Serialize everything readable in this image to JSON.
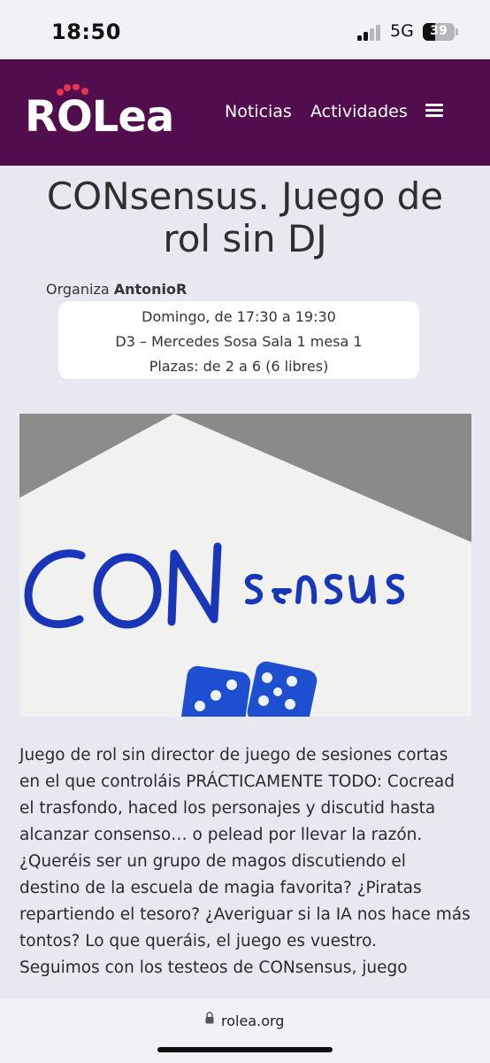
{
  "status_bar": {
    "time": "18:50",
    "network": "5G",
    "battery": "39",
    "battery_level": 0.39
  },
  "header": {
    "logo_text": "ROLea",
    "nav": [
      "Noticias",
      "Actividades"
    ],
    "menu_icon": "hamburger-menu-icon",
    "brand_color": "#520d4f",
    "logo_accent": "#e8344e"
  },
  "activity": {
    "title": "CONsensus. Juego de rol sin DJ",
    "organizer_prefix": "Organiza",
    "organizer": "AntonioR",
    "schedule": "Domingo, de 17:30 a 19:30",
    "location": "D3 – Mercedes Sosa Sala 1 mesa 1",
    "slots": "Plazas: de 2 a 6 (6 libres)"
  },
  "image": {
    "handwritten_text": "CONsensus",
    "dice_color": "#1e4fd0"
  },
  "description": {
    "paragraph1": "Juego de rol sin director de juego de sesiones cortas en el que controláis PRÁCTICAMENTE TODO: Cocread el trasfondo, haced los personajes y discutid hasta alcanzar consenso… o pelead por llevar la razón. ¿Queréis ser un grupo de magos discutiendo el destino de la escuela de magia favorita? ¿Piratas repartiendo el tesoro? ¿Averiguar si la IA nos hace más tontos? Lo que queráis, el juego es vuestro.",
    "paragraph2": "Seguimos con los testeos de CONsensus, juego"
  },
  "browser": {
    "url": "rolea.org",
    "lock_icon": "lock-icon"
  }
}
